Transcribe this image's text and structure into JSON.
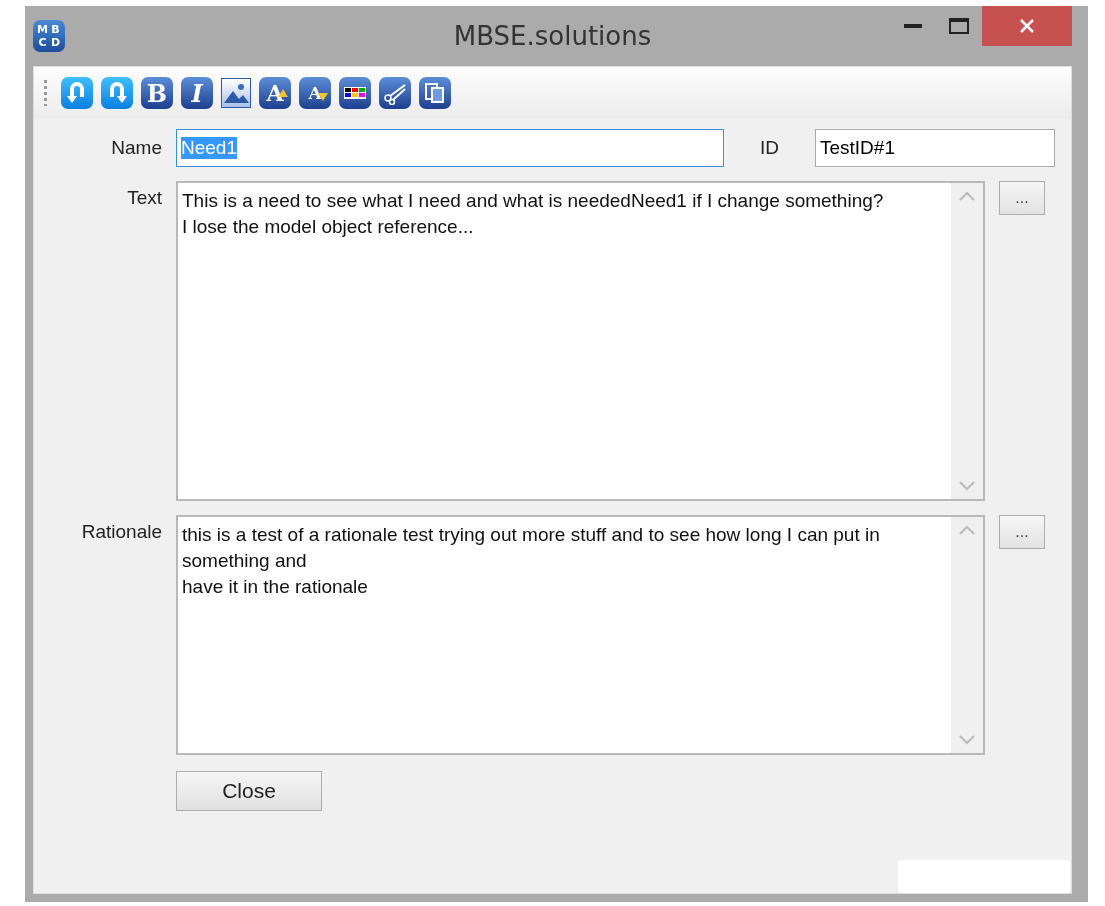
{
  "window": {
    "title": "MBSE.solutions",
    "logo_letters": [
      "M",
      "B",
      "C",
      "D"
    ]
  },
  "toolbar": [
    {
      "kind": "undo"
    },
    {
      "kind": "redo"
    },
    {
      "kind": "bold",
      "glyph": "B"
    },
    {
      "kind": "italic",
      "glyph": "I"
    },
    {
      "kind": "image"
    },
    {
      "kind": "grow",
      "glyph": "A"
    },
    {
      "kind": "shrink",
      "glyph": "A"
    },
    {
      "kind": "color"
    },
    {
      "kind": "cut"
    },
    {
      "kind": "copy"
    }
  ],
  "name": {
    "label": "Name",
    "value": "Need1",
    "text_selected": true,
    "focused": true
  },
  "id": {
    "label": "ID",
    "value": "TestID#1"
  },
  "text": {
    "label": "Text",
    "value": "This is a need to see what I need and what is neededNeed1 if I change something?\nI lose the model object reference...",
    "button": "..."
  },
  "rationale": {
    "label": "Rationale",
    "value": "this is a test of a rationale test trying out more stuff and to see how long I can put in\nsomething and\nhave it in the rationale",
    "button": "..."
  },
  "close_button": "Close"
}
